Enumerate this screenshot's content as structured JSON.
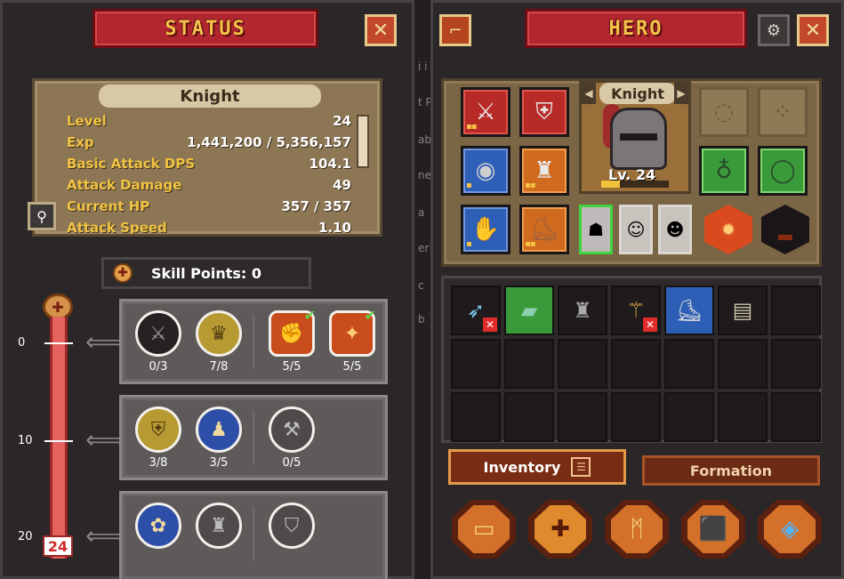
{
  "status_panel": {
    "title": "STATUS",
    "close": "✕",
    "card": {
      "name": "Knight",
      "rows": [
        {
          "k": "Level",
          "v": "24"
        },
        {
          "k": "Exp",
          "v": "1,441,200 / 5,356,157"
        },
        {
          "k": "Basic Attack DPS",
          "v": "104.1"
        },
        {
          "k": "Attack Damage",
          "v": "49"
        },
        {
          "k": "Current HP",
          "v": "357 / 357"
        },
        {
          "k": "Attack Speed",
          "v": "1.10"
        }
      ]
    },
    "skill_points_label": "Skill Points: 0",
    "tiers": [
      "0",
      "10",
      "20"
    ],
    "current_tier_level": "24",
    "skill_rows": [
      {
        "skills": [
          {
            "count": "0/3",
            "style": "dark",
            "glyph": "⚔",
            "checked": false
          },
          {
            "count": "7/8",
            "style": "gold",
            "glyph": "♛",
            "checked": false
          },
          {
            "count": "5/5",
            "style": "red",
            "glyph": "✊",
            "checked": true
          },
          {
            "count": "5/5",
            "style": "red",
            "glyph": "✦",
            "checked": true
          }
        ]
      },
      {
        "skills": [
          {
            "count": "3/8",
            "style": "gold",
            "glyph": "⛨",
            "checked": false
          },
          {
            "count": "3/5",
            "style": "blue",
            "glyph": "♟",
            "checked": false
          },
          {
            "count": "0/5",
            "style": "grey",
            "glyph": "⚒",
            "checked": false
          }
        ]
      },
      {
        "skills": [
          {
            "count": "",
            "style": "blue",
            "glyph": "✿",
            "checked": false
          },
          {
            "count": "",
            "style": "grey",
            "glyph": "♜",
            "checked": false
          },
          {
            "count": "",
            "style": "grey",
            "glyph": "⛉",
            "checked": false
          }
        ]
      }
    ]
  },
  "hero_panel": {
    "title": "HERO",
    "close": "✕",
    "portrait": {
      "name": "Knight",
      "level_text": "Lv. 24",
      "exp_fraction": 0.27
    },
    "inventory_tab": "Inventory",
    "formation_tab": "Formation",
    "gutter_glyphs": [
      "i i",
      "t P",
      "ab",
      "ne",
      "a",
      "er",
      "c",
      "b"
    ]
  },
  "colors": {
    "accent_red": "#b22630",
    "gold": "#f1c443",
    "tier_bar": "#e5625f"
  }
}
